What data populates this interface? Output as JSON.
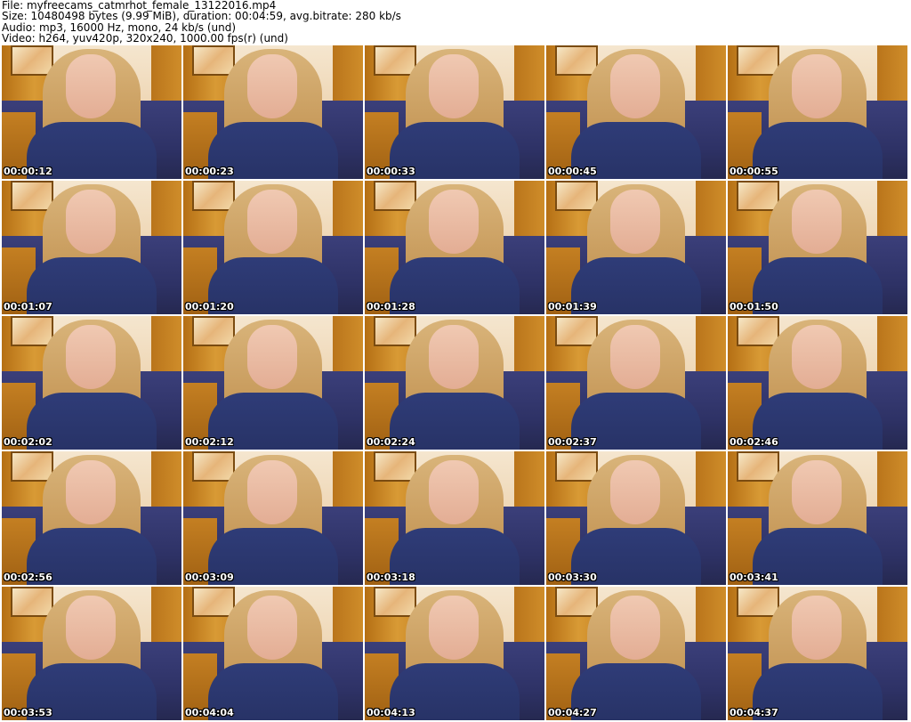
{
  "header": {
    "file": "File: myfreecams_catmrhot_female_13122016.mp4",
    "size": "Size: 10480498 bytes (9.99 MiB), duration: 00:04:59, avg.bitrate: 280 kb/s",
    "audio": "Audio: mp3, 16000 Hz, mono, 24 kb/s (und)",
    "video": "Video: h264, yuv420p, 320x240, 1000.00 fps(r) (und)"
  },
  "timestamps": [
    "00:00:12",
    "00:00:23",
    "00:00:33",
    "00:00:45",
    "00:00:55",
    "00:01:07",
    "00:01:20",
    "00:01:28",
    "00:01:39",
    "00:01:50",
    "00:02:02",
    "00:02:12",
    "00:02:24",
    "00:02:37",
    "00:02:46",
    "00:02:56",
    "00:03:09",
    "00:03:18",
    "00:03:30",
    "00:03:41",
    "00:03:53",
    "00:04:04",
    "00:04:13",
    "00:04:27",
    "00:04:37"
  ]
}
